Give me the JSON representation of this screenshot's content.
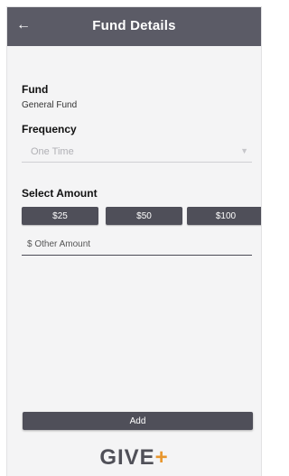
{
  "header": {
    "title": "Fund Details",
    "back_icon": "arrow-left-icon"
  },
  "fund": {
    "label": "Fund",
    "value": "General Fund"
  },
  "frequency": {
    "label": "Frequency",
    "selected": "One Time",
    "arrow_icon": "chevron-down-icon"
  },
  "amount": {
    "label": "Select Amount",
    "options": [
      "$25",
      "$50",
      "$100"
    ],
    "other_placeholder": "$ Other Amount"
  },
  "add_button": {
    "label": "Add"
  },
  "logo": {
    "text": "GIVE",
    "plus": "+",
    "accent_color": "#e8962e"
  },
  "colors": {
    "header_bg": "#5b5b66",
    "button_bg": "#4f4f59",
    "screen_bg": "#f4f4f5"
  }
}
